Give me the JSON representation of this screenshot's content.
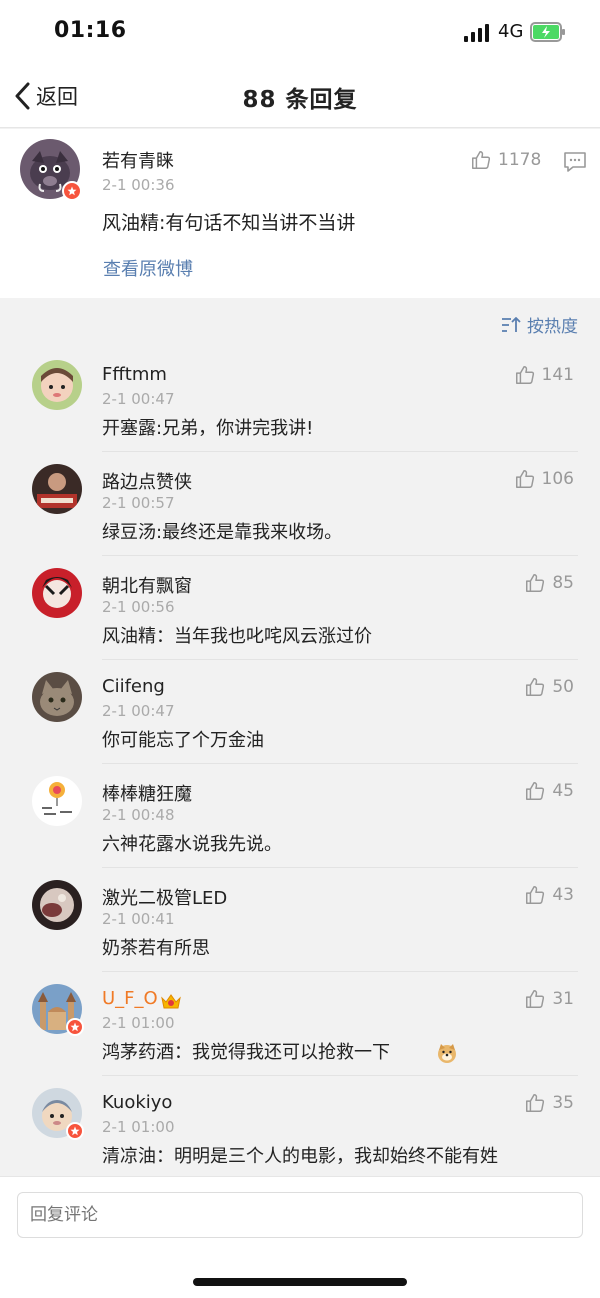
{
  "status_bar": {
    "time": "01:16",
    "network": "4G"
  },
  "nav": {
    "back_label": "返回",
    "title": "88 条回复"
  },
  "main_comment": {
    "username": "若有青睐",
    "timestamp": "2-1 00:36",
    "text": "风油精:有句话不知当讲不当讲",
    "view_original": "查看原微博",
    "likes": "1178"
  },
  "sort": {
    "label": "按热度"
  },
  "replies": [
    {
      "username": "Ffftmm",
      "timestamp": "2-1 00:47",
      "text": "开塞露:兄弟，你讲完我讲!",
      "likes": "141",
      "avatar_color": "#e9c6b3"
    },
    {
      "username": "路边点赞侠",
      "timestamp": "2-1 00:57",
      "text": "绿豆汤:最终还是靠我来收场。",
      "likes": "106",
      "avatar_color": "#a3342c"
    },
    {
      "username": "朝北有飘窗",
      "timestamp": "2-1 00:56",
      "text": "风油精：当年我也叱咤风云涨过价",
      "likes": "85",
      "avatar_color": "#c8202a"
    },
    {
      "username": "Ciifeng",
      "timestamp": "2-1 00:47",
      "text": "你可能忘了个万金油",
      "likes": "50",
      "avatar_color": "#8a7a6a"
    },
    {
      "username": "棒棒糖狂魔",
      "timestamp": "2-1 00:48",
      "text": "六神花露水说我先说。",
      "likes": "45",
      "avatar_color": "#ffffff"
    },
    {
      "username": "激光二极管LED",
      "timestamp": "2-1 00:41",
      "text": "奶茶若有所思",
      "likes": "43",
      "avatar_color": "#4a3a3a"
    },
    {
      "username": "U_F_O",
      "timestamp": "2-1 01:00",
      "text": "鸿茅药酒：我觉得我还可以抢救一下",
      "likes": "31",
      "avatar_color": "#7aa0c8"
    },
    {
      "username": "Kuokiyo",
      "timestamp": "2-1 01:00",
      "text": "清凉油：明明是三个人的电影，我却始终不能有姓",
      "likes": "35",
      "avatar_color": "#cfd8e0"
    }
  ],
  "input": {
    "placeholder": "回复评论"
  },
  "colors": {
    "link": "#5a7fb0",
    "vip_name": "#f07a26",
    "badge": "#f7543d"
  }
}
